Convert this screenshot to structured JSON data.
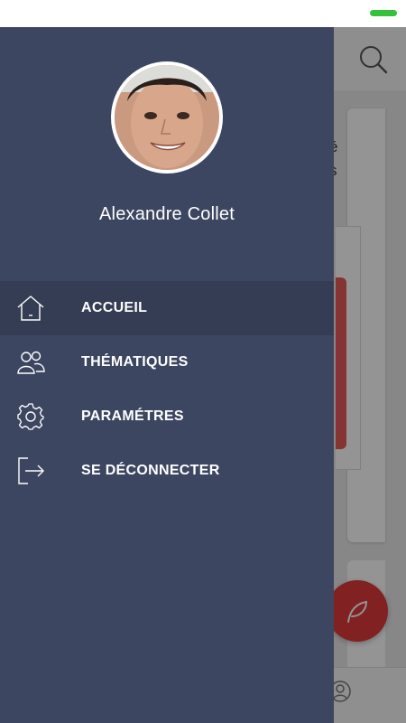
{
  "drawer": {
    "user_name": "Alexandre Collet",
    "menu": [
      {
        "label": "ACCUEIL",
        "icon": "home-icon",
        "active": true
      },
      {
        "label": "THÉMATIQUES",
        "icon": "users-icon",
        "active": false
      },
      {
        "label": "PARAMÉTRES",
        "icon": "gear-icon",
        "active": false
      },
      {
        "label": "SE DÉCONNECTER",
        "icon": "logout-icon",
        "active": false
      }
    ]
  },
  "background": {
    "card_text": "é\ns"
  },
  "colors": {
    "drawer_bg": "#3c4660",
    "active_item_bg": "#343d53",
    "accent": "#e03a3a",
    "battery": "#33c23a"
  }
}
